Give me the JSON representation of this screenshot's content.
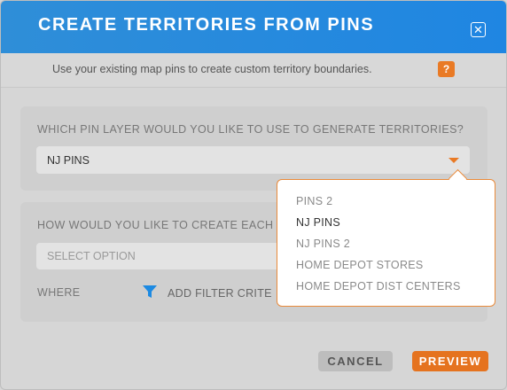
{
  "header": {
    "title": "CREATE TERRITORIES FROM PINS"
  },
  "subheader": {
    "text": "Use your existing map pins to create custom territory boundaries.",
    "help": "?"
  },
  "section1": {
    "label": "WHICH PIN LAYER WOULD YOU LIKE TO USE TO GENERATE TERRITORIES?",
    "selected": "NJ PINS"
  },
  "section2": {
    "label": "HOW WOULD YOU LIKE TO CREATE EACH",
    "placeholder": "SELECT OPTION",
    "where_label": "WHERE",
    "add_filter": "ADD FILTER CRITE"
  },
  "dropdown": {
    "options": [
      "PINS 2",
      "NJ PINS",
      "NJ PINS 2",
      "HOME DEPOT STORES",
      "HOME DEPOT DIST CENTERS"
    ],
    "selected": "NJ PINS"
  },
  "footer": {
    "cancel": "CANCEL",
    "preview": "PREVIEW"
  },
  "colors": {
    "accent": "#e97a25",
    "header": "#2f8ed8"
  },
  "icons": {
    "close": "close-icon",
    "filter": "filter-icon",
    "caret": "caret-down-icon"
  }
}
